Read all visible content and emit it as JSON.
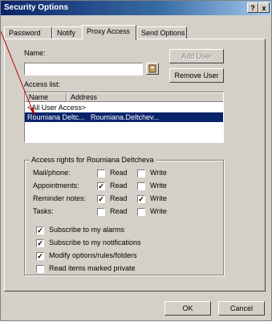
{
  "window": {
    "title": "Security Options",
    "help_btn": "?",
    "close_btn": "x"
  },
  "tabs": [
    {
      "label": "Password"
    },
    {
      "label": "Notify"
    },
    {
      "label": "Proxy Access"
    },
    {
      "label": "Send Options"
    }
  ],
  "form": {
    "name_label": "Name:",
    "name_value": "",
    "add_user": "Add User",
    "remove_user": "Remove User",
    "access_list_label": "Access list:",
    "col_name": "Name",
    "col_address": "Address",
    "rows": [
      {
        "name": "<All User Access>",
        "address": ""
      },
      {
        "name": "Roumiana Deltc...",
        "address": "Roumiana.Deltchev..."
      }
    ]
  },
  "rights": {
    "title": "Access rights for Roumiana Deltcheva",
    "read_label": "Read",
    "write_label": "Write",
    "items": [
      {
        "label": "Mail/phone:",
        "read": false,
        "write": false
      },
      {
        "label": "Appointments:",
        "read": true,
        "write": false
      },
      {
        "label": "Reminder notes:",
        "read": true,
        "write": true
      },
      {
        "label": "Tasks:",
        "read": false,
        "write": false
      }
    ],
    "options": [
      {
        "label": "Subscribe to my alarms",
        "checked": true
      },
      {
        "label": "Subscribe to my notifications",
        "checked": true
      },
      {
        "label": "Modify options/rules/folders",
        "checked": true
      },
      {
        "label": "Read items marked private",
        "checked": false
      }
    ]
  },
  "footer": {
    "ok": "OK",
    "cancel": "Cancel"
  }
}
